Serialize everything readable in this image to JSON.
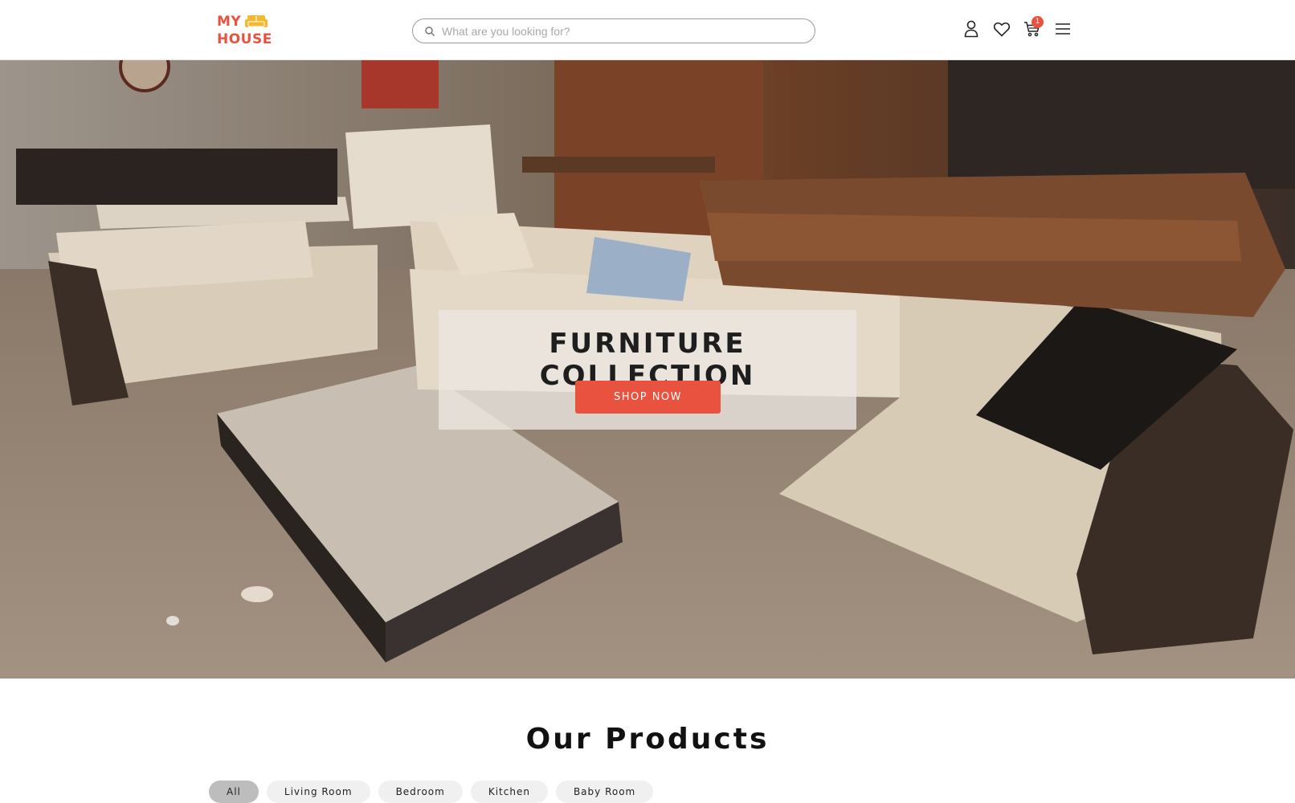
{
  "brand": {
    "line1": "MY",
    "line2": "HOUSE",
    "color": "#e8523f",
    "icon_color": "#f5b92f"
  },
  "search": {
    "placeholder": "What are you looking for?",
    "icon": "search-icon"
  },
  "header_icons": [
    "user-icon",
    "heart-icon",
    "cart-icon",
    "menu-icon"
  ],
  "cart": {
    "count": "1"
  },
  "hero": {
    "title": "FURNITURE COLLECTION",
    "button_label": "SHOP NOW",
    "accent": "#e8523f"
  },
  "products": {
    "title": "Our Products",
    "filters": [
      "All",
      "Living Room",
      "Bedroom",
      "Kitchen",
      "Baby Room"
    ],
    "active_filter": "All"
  }
}
